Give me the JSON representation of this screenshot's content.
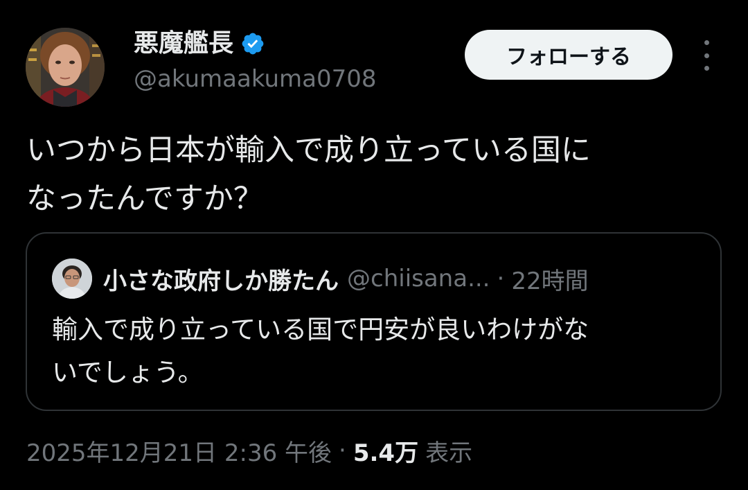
{
  "colors": {
    "background": "#000000",
    "text_primary": "#e7e9ea",
    "text_secondary": "#71767b",
    "verified_badge": "#1d9bf0",
    "follow_button_bg": "#eff3f4",
    "follow_button_text": "#0f1419",
    "card_border": "#2f3336"
  },
  "tweet": {
    "author": {
      "display_name": "悪魔艦長",
      "handle": "@akumaakuma0708",
      "verified": true,
      "avatar_icon": "profile-photo",
      "badge_icon": "verified-badge-icon"
    },
    "follow_label": "フォローする",
    "more_icon": "more-vertical-icon",
    "text_lines": [
      "いつから日本が輸入で成り立っている国に",
      "なったんですか？"
    ],
    "quote": {
      "display_name": "小さな政府しか勝たん",
      "handle": "@chiisana...",
      "separator": "·",
      "time": "22時間",
      "avatar_icon": "profile-photo",
      "text_lines": [
        "輸入で成り立っている国で円安が良いわけがな",
        "いでしょう。"
      ]
    },
    "meta": {
      "timestamp": "2025年12月21日 2:36 午後",
      "separator": "·",
      "views_count": "5.4万",
      "views_label": "表示"
    }
  }
}
